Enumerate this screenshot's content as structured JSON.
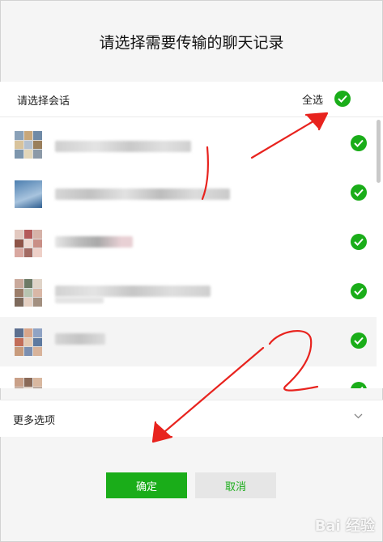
{
  "dialog": {
    "title": "请选择需要传输的聊天记录"
  },
  "selection_header": {
    "label": "请选择会话",
    "select_all_label": "全选",
    "select_all_checked": true
  },
  "conversations": [
    {
      "checked": true,
      "highlighted": false,
      "name_obscured": true
    },
    {
      "checked": true,
      "highlighted": false,
      "name_obscured": true
    },
    {
      "checked": true,
      "highlighted": false,
      "name_obscured": true
    },
    {
      "checked": true,
      "highlighted": false,
      "name_obscured": true
    },
    {
      "checked": true,
      "highlighted": true,
      "name_obscured": true
    },
    {
      "checked": true,
      "highlighted": false,
      "name_obscured": true
    }
  ],
  "more_options": {
    "label": "更多选项",
    "icon": "chevron-down-icon"
  },
  "buttons": {
    "confirm_label": "确定",
    "cancel_label": "取消"
  },
  "watermark": {
    "text": "Bai 经验"
  },
  "colors": {
    "accent": "#1aad19",
    "annotation": "#e8231e"
  }
}
